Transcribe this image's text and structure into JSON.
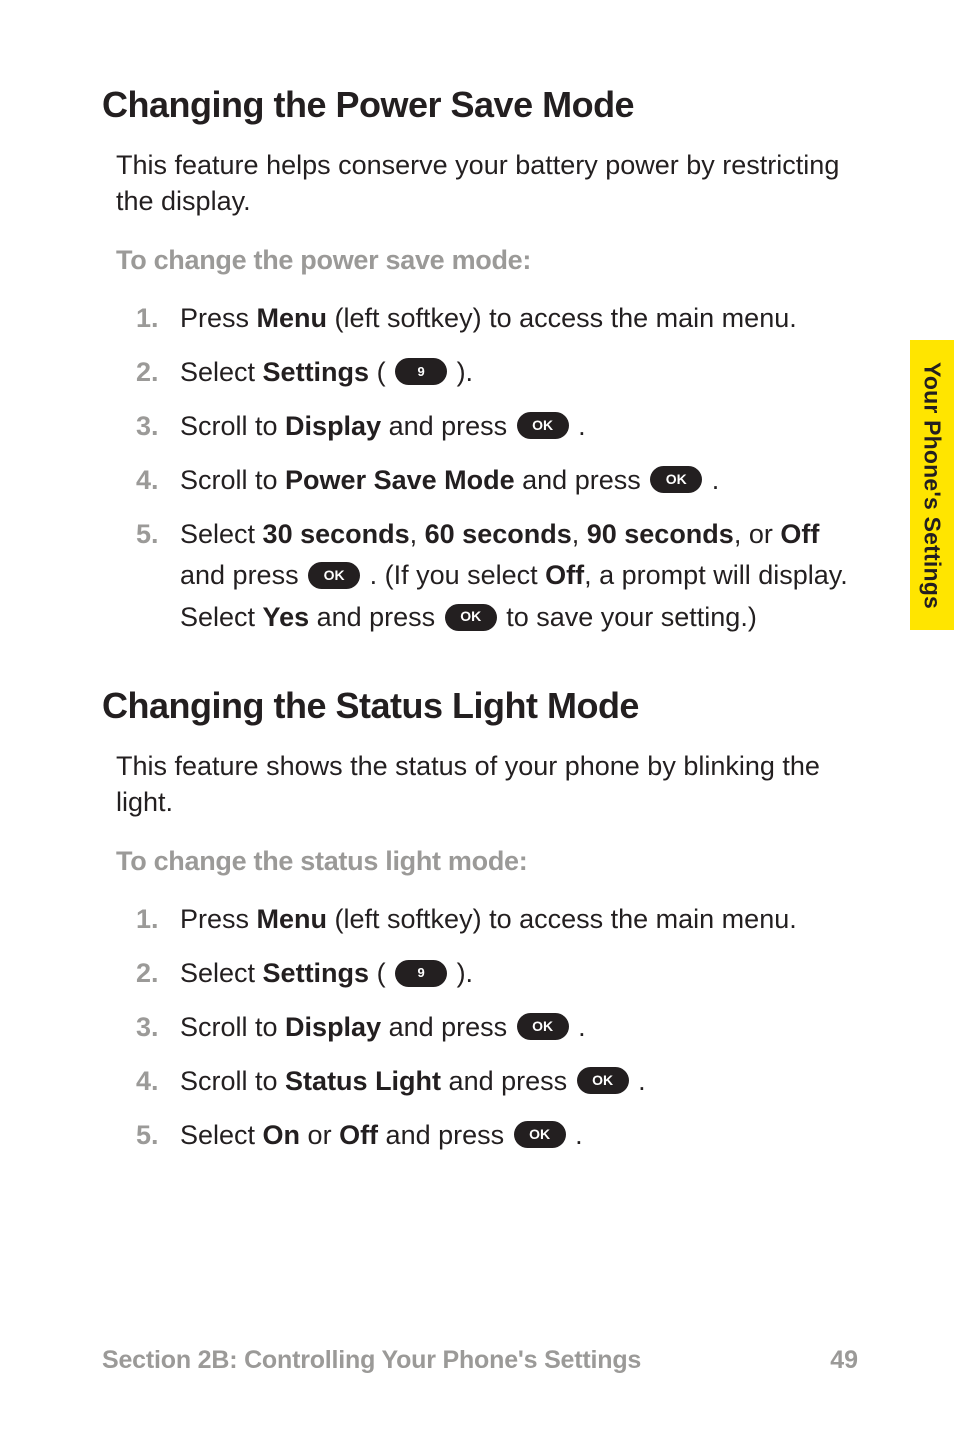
{
  "sideTab": "Your Phone's Settings",
  "section1": {
    "heading": "Changing the Power Save Mode",
    "intro": "This feature helps conserve your battery power by restricting the display.",
    "subhead": "To change the power save mode:",
    "steps": {
      "n1": "1.",
      "n2": "2.",
      "n3": "3.",
      "n4": "4.",
      "n5": "5.",
      "s1_a": "Press ",
      "s1_b": "Menu",
      "s1_c": " (left softkey) to access the main menu.",
      "s2_a": "Select ",
      "s2_b": "Settings",
      "s2_c": " ( ",
      "s2_key": "9",
      "s2_d": " ).",
      "s3_a": "Scroll to ",
      "s3_b": "Display",
      "s3_c": " and press ",
      "s3_key": "OK",
      "s3_d": " .",
      "s4_a": "Scroll to ",
      "s4_b": "Power Save Mode",
      "s4_c": " and press ",
      "s4_key": "OK",
      "s4_d": " .",
      "s5_a": "Select ",
      "s5_b": "30 seconds",
      "s5_c": ", ",
      "s5_d": "60 seconds",
      "s5_e": ", ",
      "s5_f": "90 seconds",
      "s5_g": ", or ",
      "s5_h": "Off",
      "s5_i": " and press ",
      "s5_key1": "OK",
      "s5_j": " . (If you select ",
      "s5_k": "Off",
      "s5_l": ", a prompt will display. Select ",
      "s5_m": "Yes",
      "s5_n": " and press ",
      "s5_key2": "OK",
      "s5_o": " to save your setting.)"
    }
  },
  "section2": {
    "heading": "Changing the Status Light Mode",
    "intro": "This feature shows the status of your phone by blinking the light.",
    "subhead": "To change the status light mode:",
    "steps": {
      "n1": "1.",
      "n2": "2.",
      "n3": "3.",
      "n4": "4.",
      "n5": "5.",
      "s1_a": "Press ",
      "s1_b": "Menu",
      "s1_c": " (left softkey) to access the main menu.",
      "s2_a": "Select ",
      "s2_b": "Settings",
      "s2_c": " ( ",
      "s2_key": "9",
      "s2_d": " ).",
      "s3_a": "Scroll to ",
      "s3_b": "Display",
      "s3_c": " and press ",
      "s3_key": "OK",
      "s3_d": " .",
      "s4_a": "Scroll to ",
      "s4_b": "Status Light",
      "s4_c": " and press ",
      "s4_key": "OK",
      "s4_d": " .",
      "s5_a": "Select ",
      "s5_b": "On",
      "s5_c": " or ",
      "s5_d": "Off",
      "s5_e": " and press ",
      "s5_key": "OK",
      "s5_f": " ."
    }
  },
  "footer": {
    "left": "Section 2B: Controlling Your Phone's Settings",
    "right": "49"
  }
}
